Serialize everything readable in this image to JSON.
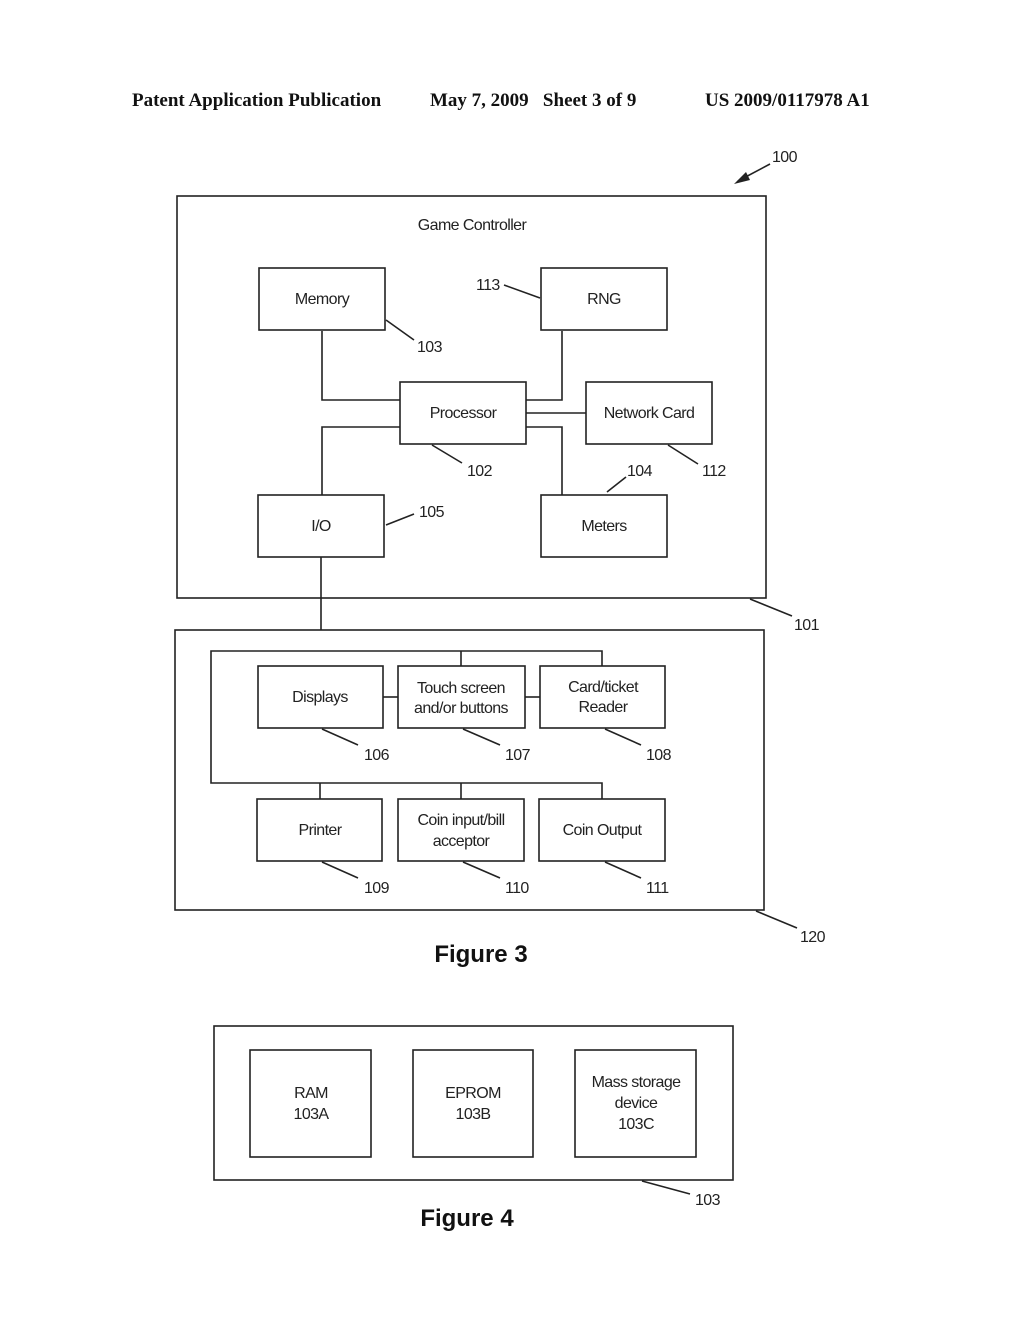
{
  "header": {
    "publication_type": "Patent Application Publication",
    "date_sheet": "May 7, 2009   Sheet 3 of 9",
    "patent_number": "US 2009/0117978 A1"
  },
  "figure3": {
    "caption": "Figure 3",
    "system_ref": "100",
    "game_controller": {
      "title": "Game Controller",
      "ref": "101",
      "blocks": {
        "memory": {
          "label": "Memory",
          "ref": "103"
        },
        "rng": {
          "label": "RNG",
          "ref": "113"
        },
        "processor": {
          "label": "Processor",
          "ref": "102"
        },
        "network_card": {
          "label": "Network Card",
          "ref": "112"
        },
        "io": {
          "label": "I/O",
          "ref": "105"
        },
        "meters": {
          "label": "Meters",
          "ref": "104"
        }
      }
    },
    "peripherals": {
      "ref": "120",
      "blocks": {
        "displays": {
          "label": "Displays",
          "ref": "106"
        },
        "touch_screen": {
          "line1": "Touch screen",
          "line2": "and/or buttons",
          "ref": "107"
        },
        "card_reader": {
          "line1": "Card/ticket",
          "line2": "Reader",
          "ref": "108"
        },
        "printer": {
          "label": "Printer",
          "ref": "109"
        },
        "coin_input": {
          "line1": "Coin input/bill",
          "line2": "acceptor",
          "ref": "110"
        },
        "coin_output": {
          "label": "Coin Output",
          "ref": "111"
        }
      }
    }
  },
  "figure4": {
    "caption": "Figure 4",
    "ref": "103",
    "blocks": {
      "ram": {
        "line1": "RAM",
        "line2": "103A"
      },
      "eprom": {
        "line1": "EPROM",
        "line2": "103B"
      },
      "mass_storage": {
        "line1": "Mass storage",
        "line2": "device",
        "line3": "103C"
      }
    }
  }
}
